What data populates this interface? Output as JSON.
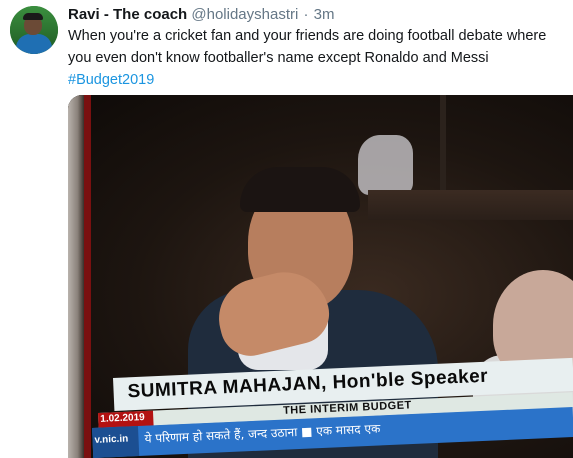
{
  "tweet": {
    "author_name": "Ravi - The coach",
    "handle": "@holidayshastri",
    "separator": "·",
    "time": "3m",
    "text": "When you're a cricket fan and your friends are doing football debate where you even don't know footballer's name except Ronaldo and Messi",
    "hashtag": "#Budget2019"
  },
  "media": {
    "caption_name": "SUMITRA MAHAJAN, Hon'ble Speaker",
    "date": "1.02.2019",
    "budget_title": "THE INTERIM BUDGET",
    "ticker_site": "v.nic.in",
    "ticker_text": "ये परिणाम हो सकते हैं, जन्द उठाना  ■  एक मासद एक"
  },
  "colors": {
    "hashtag": "#1b95e0",
    "secondary_text": "#657786",
    "ticker_blue": "#2b73c9",
    "date_red": "#b31212"
  }
}
